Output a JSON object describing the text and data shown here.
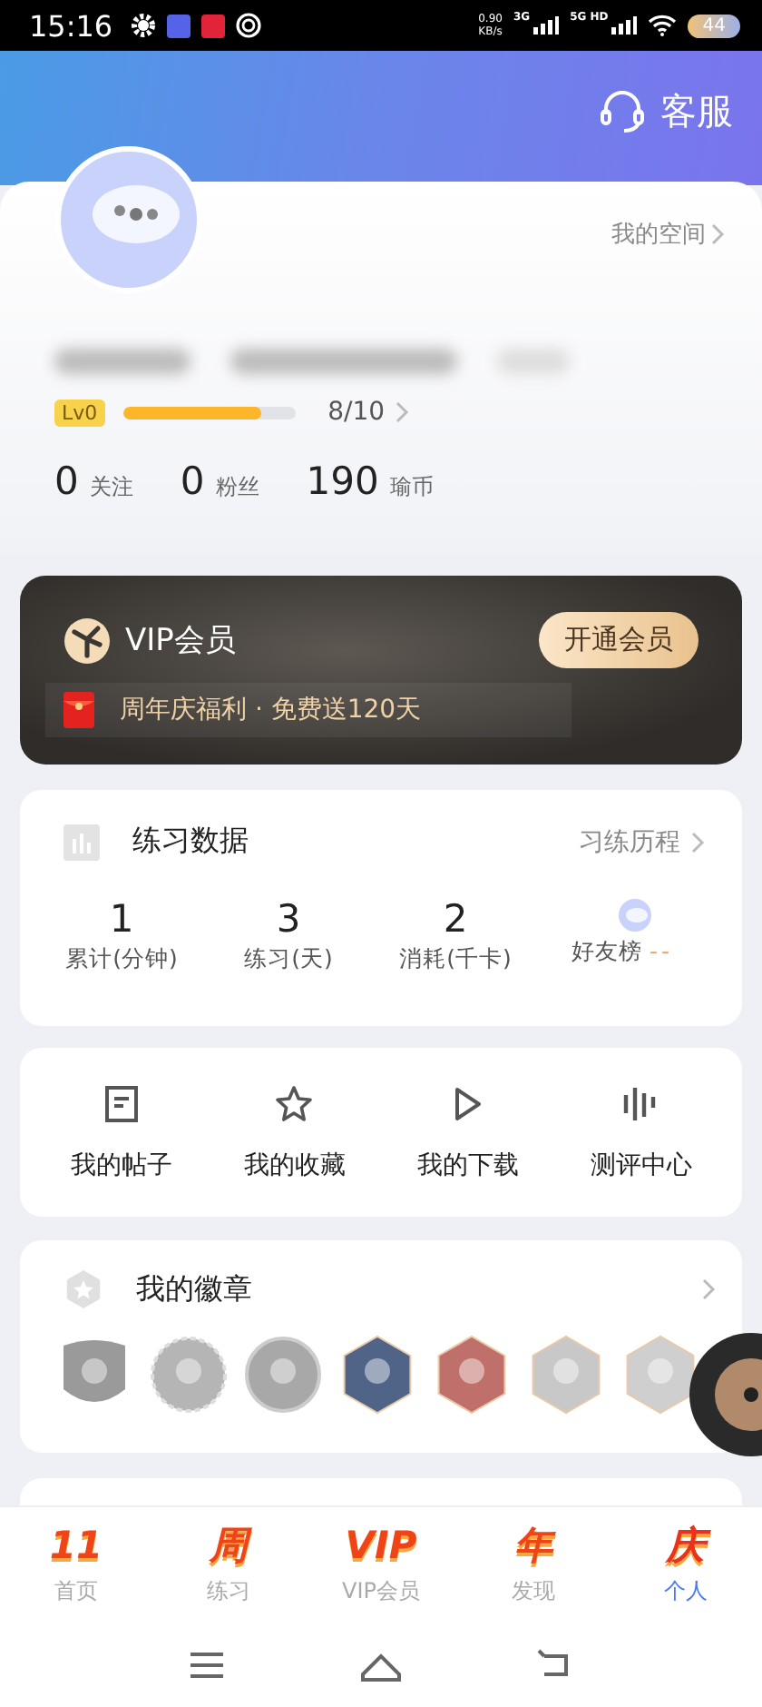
{
  "status_bar": {
    "time": "15:16",
    "speed": "0.90",
    "speed_unit": "KB/s",
    "net1": "3G",
    "net2": "5G HD",
    "battery": "44"
  },
  "header": {
    "service": "客服"
  },
  "profile": {
    "space_link": "我的空间",
    "level_badge": "Lv0",
    "level": 0.8,
    "level_text": "8/10",
    "stats": [
      {
        "value": "0",
        "label": "关注"
      },
      {
        "value": "0",
        "label": "粉丝"
      },
      {
        "value": "190",
        "label": "瑜币"
      }
    ]
  },
  "vip": {
    "title": "VIP会员",
    "button": "开通会员",
    "promo": "周年庆福利 · 免费送120天"
  },
  "practice": {
    "title": "练习数据",
    "link": "习练历程",
    "stats": [
      {
        "value": "1",
        "label": "累计(分钟)",
        "kind": "stat"
      },
      {
        "value": "3",
        "label": "练习(天)",
        "kind": "stat"
      },
      {
        "value": "2",
        "label": "消耗(千卡)",
        "kind": "stat"
      },
      {
        "label": "好友榜",
        "value": "--",
        "kind": "rank"
      }
    ]
  },
  "shortcuts": [
    {
      "label": "我的帖子",
      "kind": "post"
    },
    {
      "label": "我的收藏",
      "kind": "star"
    },
    {
      "label": "我的下载",
      "kind": "play"
    },
    {
      "label": "测评中心",
      "kind": "bars"
    }
  ],
  "badges": {
    "title": "我的徽章",
    "items": [
      {
        "kind": "shield",
        "color": "#9a9a9a"
      },
      {
        "kind": "gear",
        "color": "#b5b5b5"
      },
      {
        "kind": "circle",
        "color": "#a8a8a8"
      },
      {
        "kind": "hex",
        "color": "#4f6487"
      },
      {
        "kind": "hex",
        "color": "#c0706a"
      },
      {
        "kind": "hex",
        "color": "#c8c8c8"
      },
      {
        "kind": "hex",
        "color": "#cfcfcf"
      }
    ]
  },
  "tabs": [
    {
      "glyph": "11",
      "label": "首页",
      "selected": false
    },
    {
      "glyph": "周",
      "label": "练习",
      "selected": false
    },
    {
      "glyph": "VIP",
      "label": "VIP会员",
      "selected": false
    },
    {
      "glyph": "年",
      "label": "发现",
      "selected": false
    },
    {
      "glyph": "庆",
      "label": "个人",
      "selected": true
    }
  ]
}
